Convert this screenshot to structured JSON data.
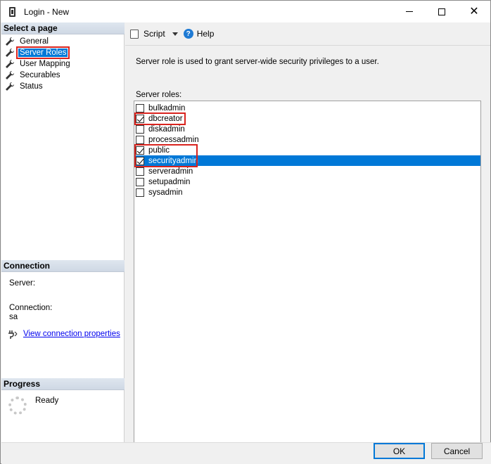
{
  "window": {
    "title": "Login - New"
  },
  "left": {
    "select_page_header": "Select a page",
    "pages": [
      {
        "label": "General",
        "selected": false
      },
      {
        "label": "Server Roles",
        "selected": true
      },
      {
        "label": "User Mapping",
        "selected": false
      },
      {
        "label": "Securables",
        "selected": false
      },
      {
        "label": "Status",
        "selected": false
      }
    ],
    "connection_header": "Connection",
    "server_label": "Server:",
    "connection_label": "Connection:",
    "connection_value": "sa",
    "view_connection_link": "View connection properties",
    "progress_header": "Progress",
    "progress_status": "Ready"
  },
  "toolbar": {
    "script_label": "Script",
    "help_label": "Help"
  },
  "main": {
    "description": "Server role is used to grant server-wide security privileges to a user.",
    "roles_label": "Server roles:",
    "roles": [
      {
        "name": "bulkadmin",
        "checked": false
      },
      {
        "name": "dbcreator",
        "checked": true
      },
      {
        "name": "diskadmin",
        "checked": false
      },
      {
        "name": "processadmin",
        "checked": false
      },
      {
        "name": "public",
        "checked": true
      },
      {
        "name": "securityadmin",
        "checked": true,
        "selected": true
      },
      {
        "name": "serveradmin",
        "checked": false
      },
      {
        "name": "setupadmin",
        "checked": false
      },
      {
        "name": "sysadmin",
        "checked": false
      }
    ]
  },
  "buttons": {
    "ok_label": "OK",
    "cancel_label": "Cancel"
  },
  "colors": {
    "selection": "#0078d7",
    "highlight": "#d9231e",
    "link": "#0000ee"
  }
}
